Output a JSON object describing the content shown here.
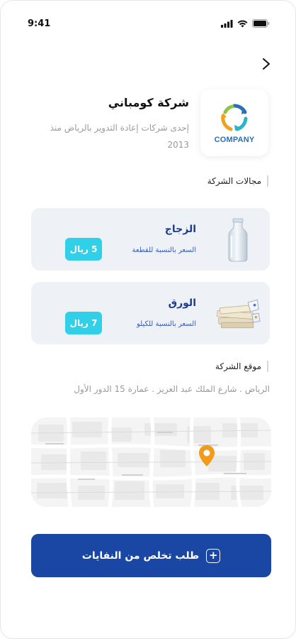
{
  "status_bar": {
    "time": "9:41"
  },
  "company": {
    "name": "شركة كومباني",
    "description": "إحدى شركات إعادة التدوير بالرياض منذ 2013",
    "logo_word": "COMPANY"
  },
  "sections": {
    "fields_title": "مجالات الشركة",
    "location_title": "موقع الشركة"
  },
  "categories": [
    {
      "name": "الزجاج",
      "unit": "السعر بالنسبة للقطعة",
      "price": "5 ريال",
      "icon": "glass-bottle-icon"
    },
    {
      "name": "الورق",
      "unit": "السعر بالنسبة للكيلو",
      "price": "7 ريال",
      "icon": "paper-stack-icon"
    }
  ],
  "location": {
    "address": "الرياض . شارع الملك عبد العزيز . عمارة 15 الدور الأول",
    "pin_color": "#f29a1a"
  },
  "cta": {
    "label": "طلب تخلص من النفايات",
    "icon": "plus-square-icon"
  },
  "colors": {
    "primary": "#1a47a3",
    "accent": "#2fd0e8",
    "card_bg": "#eef2f7"
  }
}
